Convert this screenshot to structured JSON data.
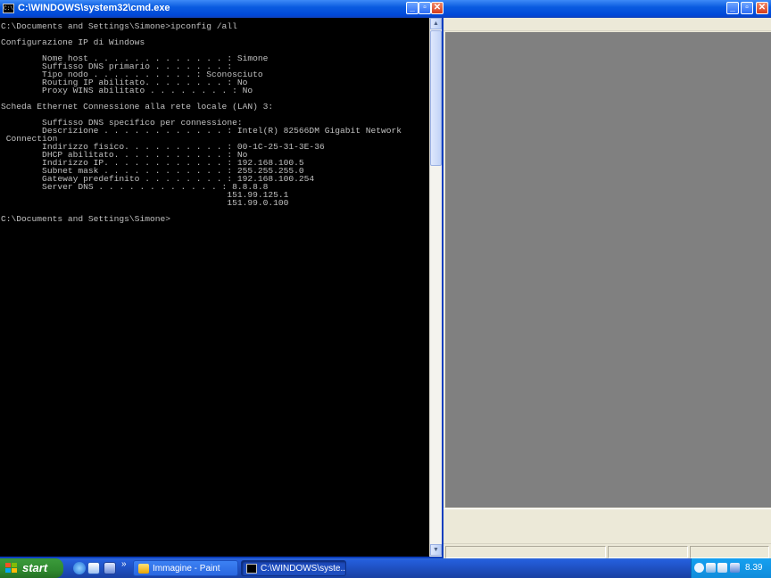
{
  "cmd_window": {
    "title": "C:\\WINDOWS\\system32\\cmd.exe",
    "icon": "console-icon",
    "console_text": "C:\\Documents and Settings\\Simone>ipconfig /all\n\nConfigurazione IP di Windows\n\n        Nome host . . . . . . . . . . . . . : Simone\n        Suffisso DNS primario . . . . . . . :\n        Tipo nodo . . . . . . . . . . : Sconosciuto\n        Routing IP abilitato. . . . . . . . : No\n        Proxy WINS abilitato . . . . . . . . : No\n\nScheda Ethernet Connessione alla rete locale (LAN) 3:\n\n        Suffisso DNS specifico per connessione:\n        Descrizione . . . . . . . . . . . . : Intel(R) 82566DM Gigabit Network\n Connection\n        Indirizzo fisico. . . . . . . . . . : 00-1C-25-31-3E-36\n        DHCP abilitato. . . . . . . . . . . : No\n        Indirizzo IP. . . . . . . . . . . . : 192.168.100.5\n        Subnet mask . . . . . . . . . . . . : 255.255.255.0\n        Gateway predefinito . . . . . . . . : 192.168.100.254\n        Server DNS . . . . . . . . . . . . : 8.8.8.8\n                                            151.99.125.1\n                                            151.99.0.100\n\nC:\\Documents and Settings\\Simone>",
    "colors": {
      "background": "#000000",
      "text": "#c0c0c0"
    }
  },
  "paint_window": {
    "icon": "paint-icon",
    "canvas_color": "#808080"
  },
  "caption_buttons": {
    "minimize": "_",
    "maximize": "▫",
    "close": "✕"
  },
  "taskbar": {
    "start_label": "start",
    "quick_launch": [
      "ie-icon",
      "outlook-icon",
      "desktop-icon"
    ],
    "more_indicator": "»",
    "buttons": [
      {
        "label": "Immagine - Paint",
        "icon": "paint-icon",
        "active": false
      },
      {
        "label": "C:\\WINDOWS\\syste...",
        "icon": "console-icon",
        "active": true
      }
    ],
    "tray": {
      "icons": [
        "back-arrow-icon",
        "network-icon",
        "volume-icon",
        "display-icon"
      ],
      "clock": "8.39"
    },
    "colors": {
      "start": "#2f8a2f",
      "bar": "#245edb",
      "tray": "#108cdb"
    }
  }
}
